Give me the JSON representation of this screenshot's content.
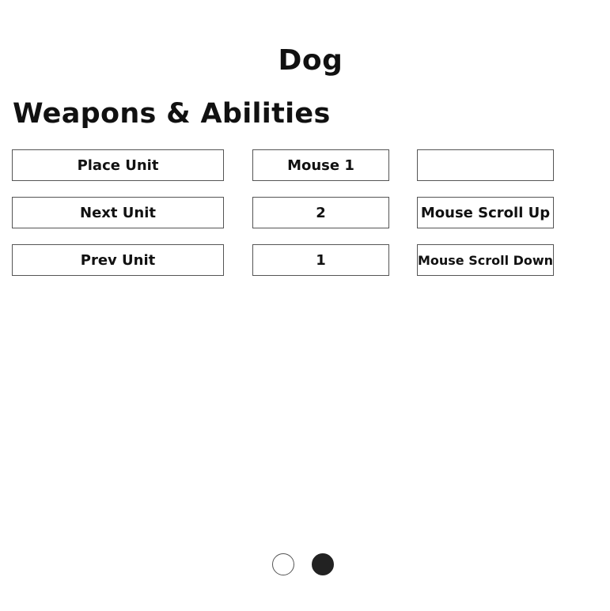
{
  "header": {
    "title": "Dog",
    "section_heading": "Weapons & Abilities"
  },
  "bindings": [
    {
      "action": "Place Unit",
      "primary": "Mouse 1",
      "secondary": ""
    },
    {
      "action": "Next Unit",
      "primary": "2",
      "secondary": "Mouse Scroll Up"
    },
    {
      "action": "Prev Unit",
      "primary": "1",
      "secondary": "Mouse Scroll Down"
    }
  ],
  "pagination": {
    "total_pages": 2,
    "current_page": 2
  },
  "colors": {
    "background": "#ffffff",
    "text": "#111111",
    "border": "#555555",
    "active_dot": "#222222"
  }
}
